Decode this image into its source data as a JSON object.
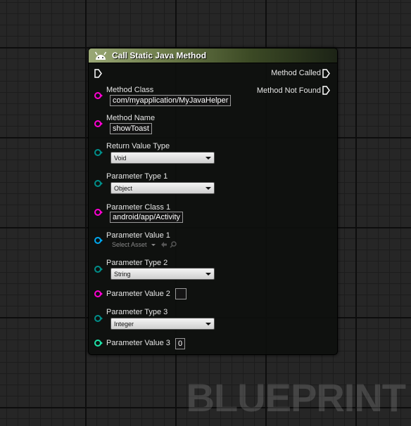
{
  "node": {
    "title": "Call Static Java Method",
    "outputs": {
      "method_called": "Method Called",
      "method_not_found": "Method Not Found"
    },
    "method_class": {
      "label": "Method Class",
      "value": "com/myapplication/MyJavaHelper"
    },
    "method_name": {
      "label": "Method Name",
      "value": "showToast"
    },
    "return_value_type": {
      "label": "Return Value Type",
      "value": "Void"
    },
    "parameter_type_1": {
      "label": "Parameter Type 1",
      "value": "Object"
    },
    "parameter_class_1": {
      "label": "Parameter Class 1",
      "value": "android/app/Activity"
    },
    "parameter_value_1": {
      "label": "Parameter Value 1",
      "value": "Select Asset"
    },
    "parameter_type_2": {
      "label": "Parameter Type 2",
      "value": "String"
    },
    "parameter_value_2": {
      "label": "Parameter Value 2",
      "value": ""
    },
    "parameter_type_3": {
      "label": "Parameter Type 3",
      "value": "Integer"
    },
    "parameter_value_3": {
      "label": "Parameter Value 3",
      "value": "0"
    }
  },
  "pin_colors": {
    "exec": "#ffffff",
    "string": "#ff00d4",
    "enum": "#008f8a",
    "object": "#00a8f0",
    "integer": "#1ee4aa"
  },
  "icons": {
    "node_icon": "android-icon",
    "asset_use": "arrow-left-icon",
    "asset_browse": "search-icon"
  },
  "watermark": "BLUEPRINT"
}
